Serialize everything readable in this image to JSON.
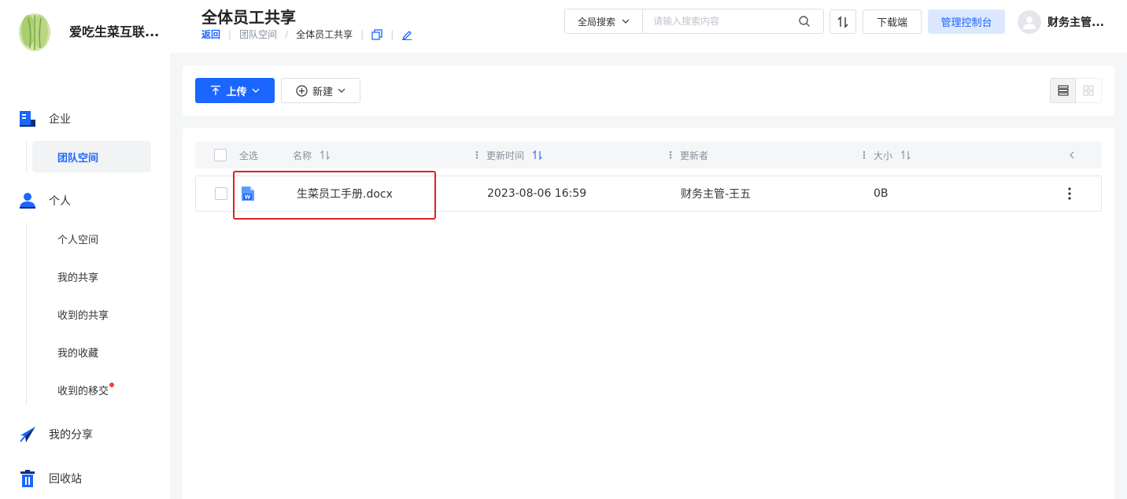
{
  "brand": {
    "name": "爱吃生菜互联..."
  },
  "nav": {
    "enterprise": {
      "label": "企业",
      "items": [
        {
          "label": "团队空间",
          "active": true
        }
      ]
    },
    "personal": {
      "label": "个人",
      "items": [
        {
          "label": "个人空间"
        },
        {
          "label": "我的共享"
        },
        {
          "label": "收到的共享"
        },
        {
          "label": "我的收藏"
        },
        {
          "label": "收到的移交",
          "badge": true
        }
      ]
    },
    "my_share": {
      "label": "我的分享"
    },
    "recycle": {
      "label": "回收站"
    }
  },
  "header": {
    "title": "全体员工共享",
    "breadcrumb": {
      "back": "返回",
      "parent": "团队空间",
      "sep": "/",
      "current": "全体员工共享"
    },
    "search": {
      "scope": "全局搜索",
      "placeholder": "请输入搜索内容"
    },
    "download_label": "下载端",
    "admin_label": "管理控制台",
    "user_name": "财务主管..."
  },
  "toolbar": {
    "upload_label": "上传",
    "new_label": "新建"
  },
  "table": {
    "select_all": "全选",
    "columns": {
      "name": "名称",
      "updated": "更新时间",
      "updater": "更新者",
      "size": "大小"
    },
    "rows": [
      {
        "name": "生菜员工手册.docx",
        "updated": "2023-08-06 16:59",
        "updater": "财务主管-王五",
        "size": "0B"
      }
    ]
  },
  "colors": {
    "accent": "#1a66ff",
    "highlight": "#e0201f",
    "badge": "#f53f3f"
  }
}
